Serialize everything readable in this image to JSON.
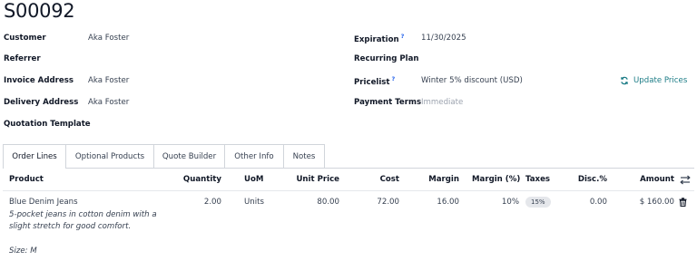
{
  "order": {
    "title": "S00092"
  },
  "fields_left": {
    "customer_label": "Customer",
    "customer_value": "Aka Foster",
    "referrer_label": "Referrer",
    "invoice_label": "Invoice Address",
    "invoice_value": "Aka Foster",
    "delivery_label": "Delivery Address",
    "delivery_value": "Aka Foster",
    "quotation_template_label": "Quotation Template"
  },
  "fields_right": {
    "expiration_label": "Expiration",
    "expiration_help": "?",
    "expiration_value": "11/30/2025",
    "recurring_plan_label": "Recurring Plan",
    "pricelist_label": "Pricelist",
    "pricelist_help": "?",
    "pricelist_value": "Winter 5% discount (USD)",
    "payment_terms_label": "Payment Terms",
    "payment_terms_placeholder": "Immediate"
  },
  "actions": {
    "update_prices": "Update Prices"
  },
  "tabs": [
    {
      "label": "Order Lines",
      "active": true
    },
    {
      "label": "Optional Products",
      "active": false
    },
    {
      "label": "Quote Builder",
      "active": false
    },
    {
      "label": "Other Info",
      "active": false
    },
    {
      "label": "Notes",
      "active": false
    }
  ],
  "table": {
    "columns": {
      "product": "Product",
      "quantity": "Quantity",
      "uom": "UoM",
      "unit_price": "Unit Price",
      "cost": "Cost",
      "margin": "Margin",
      "margin_pct": "Margin (%)",
      "taxes": "Taxes",
      "disc": "Disc.%",
      "amount": "Amount"
    },
    "rows": [
      {
        "product": "Blue Denim Jeans",
        "description_1": "5-pocket jeans in cotton denim with a",
        "description_2": "slight stretch for good comfort.",
        "description_3": "Size: M",
        "quantity": "2.00",
        "uom": "Units",
        "unit_price": "80.00",
        "cost": "72.00",
        "margin": "16.00",
        "margin_pct": "10%",
        "tax": "15%",
        "disc": "0.00",
        "amount": "$ 160.00"
      }
    ]
  },
  "icons": {
    "update_prices": "refresh-icon",
    "column_settings": "sliders-icon",
    "delete_row": "trash-icon"
  },
  "colors": {
    "accent_link": "#1c7c86",
    "help_mark": "#2563eb"
  }
}
